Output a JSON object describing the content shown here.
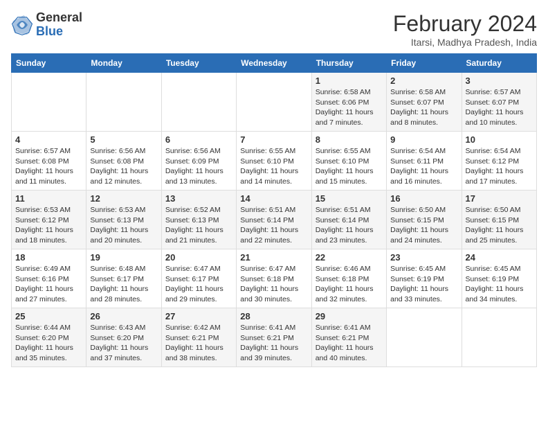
{
  "header": {
    "logo_general": "General",
    "logo_blue": "Blue",
    "month_title": "February 2024",
    "location": "Itarsi, Madhya Pradesh, India"
  },
  "days_of_week": [
    "Sunday",
    "Monday",
    "Tuesday",
    "Wednesday",
    "Thursday",
    "Friday",
    "Saturday"
  ],
  "weeks": [
    [
      {
        "day": "",
        "info": ""
      },
      {
        "day": "",
        "info": ""
      },
      {
        "day": "",
        "info": ""
      },
      {
        "day": "",
        "info": ""
      },
      {
        "day": "1",
        "info": "Sunrise: 6:58 AM\nSunset: 6:06 PM\nDaylight: 11 hours and 7 minutes."
      },
      {
        "day": "2",
        "info": "Sunrise: 6:58 AM\nSunset: 6:07 PM\nDaylight: 11 hours and 8 minutes."
      },
      {
        "day": "3",
        "info": "Sunrise: 6:57 AM\nSunset: 6:07 PM\nDaylight: 11 hours and 10 minutes."
      }
    ],
    [
      {
        "day": "4",
        "info": "Sunrise: 6:57 AM\nSunset: 6:08 PM\nDaylight: 11 hours and 11 minutes."
      },
      {
        "day": "5",
        "info": "Sunrise: 6:56 AM\nSunset: 6:08 PM\nDaylight: 11 hours and 12 minutes."
      },
      {
        "day": "6",
        "info": "Sunrise: 6:56 AM\nSunset: 6:09 PM\nDaylight: 11 hours and 13 minutes."
      },
      {
        "day": "7",
        "info": "Sunrise: 6:55 AM\nSunset: 6:10 PM\nDaylight: 11 hours and 14 minutes."
      },
      {
        "day": "8",
        "info": "Sunrise: 6:55 AM\nSunset: 6:10 PM\nDaylight: 11 hours and 15 minutes."
      },
      {
        "day": "9",
        "info": "Sunrise: 6:54 AM\nSunset: 6:11 PM\nDaylight: 11 hours and 16 minutes."
      },
      {
        "day": "10",
        "info": "Sunrise: 6:54 AM\nSunset: 6:12 PM\nDaylight: 11 hours and 17 minutes."
      }
    ],
    [
      {
        "day": "11",
        "info": "Sunrise: 6:53 AM\nSunset: 6:12 PM\nDaylight: 11 hours and 18 minutes."
      },
      {
        "day": "12",
        "info": "Sunrise: 6:53 AM\nSunset: 6:13 PM\nDaylight: 11 hours and 20 minutes."
      },
      {
        "day": "13",
        "info": "Sunrise: 6:52 AM\nSunset: 6:13 PM\nDaylight: 11 hours and 21 minutes."
      },
      {
        "day": "14",
        "info": "Sunrise: 6:51 AM\nSunset: 6:14 PM\nDaylight: 11 hours and 22 minutes."
      },
      {
        "day": "15",
        "info": "Sunrise: 6:51 AM\nSunset: 6:14 PM\nDaylight: 11 hours and 23 minutes."
      },
      {
        "day": "16",
        "info": "Sunrise: 6:50 AM\nSunset: 6:15 PM\nDaylight: 11 hours and 24 minutes."
      },
      {
        "day": "17",
        "info": "Sunrise: 6:50 AM\nSunset: 6:15 PM\nDaylight: 11 hours and 25 minutes."
      }
    ],
    [
      {
        "day": "18",
        "info": "Sunrise: 6:49 AM\nSunset: 6:16 PM\nDaylight: 11 hours and 27 minutes."
      },
      {
        "day": "19",
        "info": "Sunrise: 6:48 AM\nSunset: 6:17 PM\nDaylight: 11 hours and 28 minutes."
      },
      {
        "day": "20",
        "info": "Sunrise: 6:47 AM\nSunset: 6:17 PM\nDaylight: 11 hours and 29 minutes."
      },
      {
        "day": "21",
        "info": "Sunrise: 6:47 AM\nSunset: 6:18 PM\nDaylight: 11 hours and 30 minutes."
      },
      {
        "day": "22",
        "info": "Sunrise: 6:46 AM\nSunset: 6:18 PM\nDaylight: 11 hours and 32 minutes."
      },
      {
        "day": "23",
        "info": "Sunrise: 6:45 AM\nSunset: 6:19 PM\nDaylight: 11 hours and 33 minutes."
      },
      {
        "day": "24",
        "info": "Sunrise: 6:45 AM\nSunset: 6:19 PM\nDaylight: 11 hours and 34 minutes."
      }
    ],
    [
      {
        "day": "25",
        "info": "Sunrise: 6:44 AM\nSunset: 6:20 PM\nDaylight: 11 hours and 35 minutes."
      },
      {
        "day": "26",
        "info": "Sunrise: 6:43 AM\nSunset: 6:20 PM\nDaylight: 11 hours and 37 minutes."
      },
      {
        "day": "27",
        "info": "Sunrise: 6:42 AM\nSunset: 6:21 PM\nDaylight: 11 hours and 38 minutes."
      },
      {
        "day": "28",
        "info": "Sunrise: 6:41 AM\nSunset: 6:21 PM\nDaylight: 11 hours and 39 minutes."
      },
      {
        "day": "29",
        "info": "Sunrise: 6:41 AM\nSunset: 6:21 PM\nDaylight: 11 hours and 40 minutes."
      },
      {
        "day": "",
        "info": ""
      },
      {
        "day": "",
        "info": ""
      }
    ]
  ]
}
